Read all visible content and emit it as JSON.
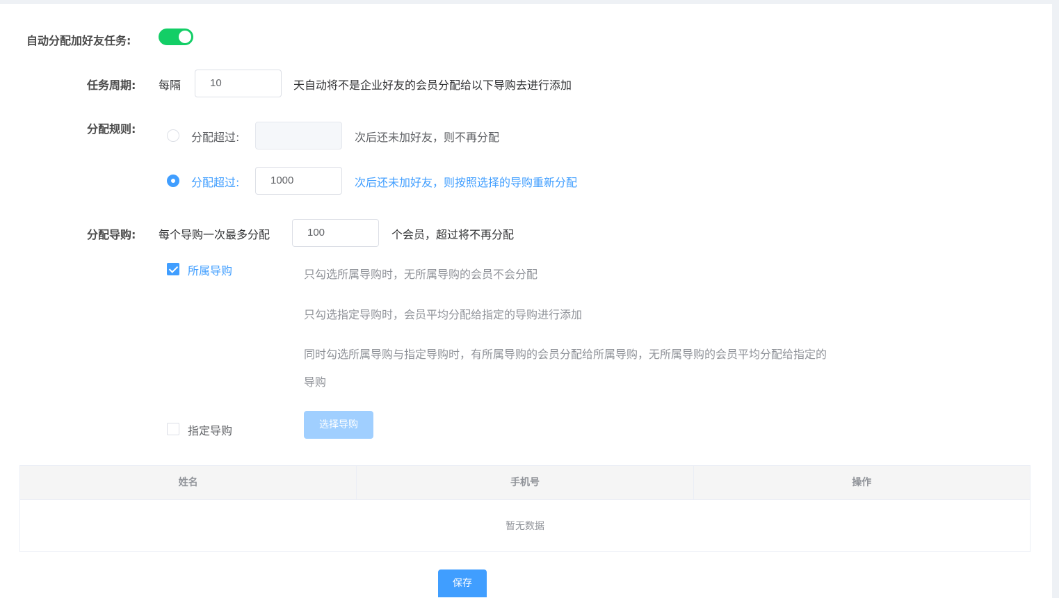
{
  "auto_assign": {
    "label": "自动分配加好友任务:",
    "enabled": true
  },
  "cycle": {
    "label": "任务周期:",
    "prefix": "每隔",
    "value": "10",
    "suffix": "天自动将不是企业好友的会员分配给以下导购去进行添加"
  },
  "rule": {
    "label": "分配规则:",
    "options": [
      {
        "prefix": "分配超过:",
        "value": "",
        "suffix": "次后还未加好友，则不再分配",
        "selected": false
      },
      {
        "prefix": "分配超过:",
        "value": "1000",
        "suffix": "次后还未加好友，则按照选择的导购重新分配",
        "selected": true
      }
    ]
  },
  "guide": {
    "label": "分配导购:",
    "prefix": "每个导购一次最多分配",
    "value": "100",
    "suffix": "个会员，超过将不再分配",
    "own_guide": {
      "label": "所属导购",
      "checked": true
    },
    "notes": [
      "只勾选所属导购时，无所属导购的会员不会分配",
      "只勾选指定导购时，会员平均分配给指定的导购进行添加",
      "同时勾选所属导购与指定导购时，有所属导购的会员分配给所属导购，无所属导购的会员平均分配给指定的",
      "导购"
    ],
    "specified_guide": {
      "label": "指定导购",
      "checked": false
    },
    "choose_button": "选择导购"
  },
  "table": {
    "columns": [
      "姓名",
      "手机号",
      "操作"
    ],
    "empty_text": "暂无数据"
  },
  "save_button": "保存",
  "colors": {
    "accent": "#409eff",
    "switch_on": "#13ce66"
  }
}
